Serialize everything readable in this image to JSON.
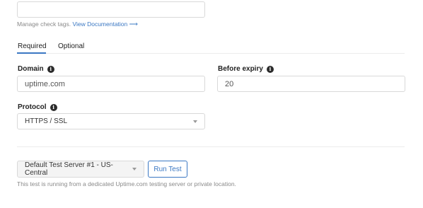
{
  "tags": {
    "help_text": "Manage check tags.",
    "link_text": "View Documentation",
    "link_arrow": "⟶"
  },
  "tabs": [
    {
      "label": "Required",
      "active": true
    },
    {
      "label": "Optional",
      "active": false
    }
  ],
  "fields": {
    "domain": {
      "label": "Domain",
      "value": "uptime.com"
    },
    "before_expiry": {
      "label": "Before expiry",
      "value": "20"
    },
    "protocol": {
      "label": "Protocol",
      "value": "HTTPS / SSL"
    }
  },
  "info_glyph": "i",
  "footer": {
    "server_select": "Default Test Server #1 - US-Central",
    "run_test_label": "Run Test",
    "note": "This test is running from a dedicated Uptime.com testing server or private location."
  },
  "colors": {
    "accent": "#3b78c3"
  }
}
